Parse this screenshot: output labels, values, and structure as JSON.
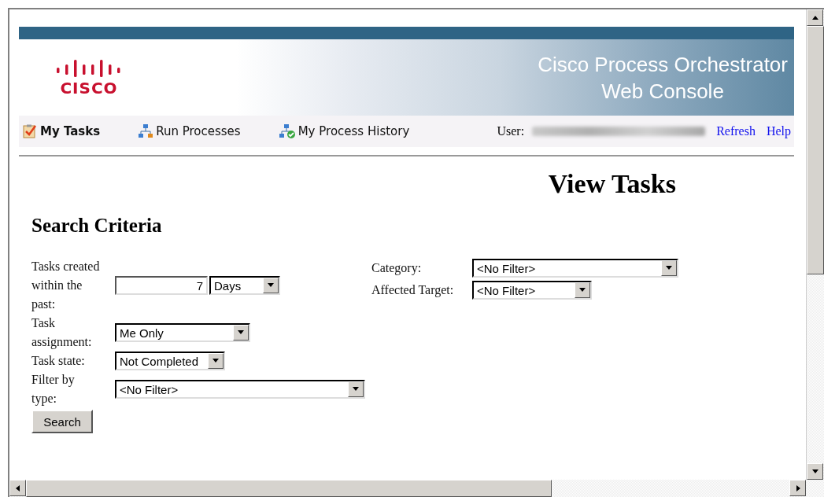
{
  "logo": {
    "wordmark": "CISCO"
  },
  "banner": {
    "title_lines": [
      "Cisco Process Orchestrator",
      "Web Console"
    ]
  },
  "nav": {
    "items": [
      {
        "label": "My Tasks",
        "kind": "tasks",
        "selected": true
      },
      {
        "label": "Run Processes",
        "kind": "run",
        "selected": false
      },
      {
        "label": "My Process History",
        "kind": "history",
        "selected": false
      }
    ],
    "user_label": "User:",
    "links": [
      "Refresh",
      "Help"
    ]
  },
  "page_title": "View Tasks",
  "section_title": "Search Criteria",
  "form_left": [
    {
      "label": "Tasks created within the past:",
      "kind": "number-unit",
      "value": "7",
      "unit": "Days"
    },
    {
      "label": "Task assignment:",
      "kind": "select",
      "value": "Me Only"
    },
    {
      "label": "Task state:",
      "kind": "select",
      "value": "Not Completed"
    },
    {
      "label": "Filter by type:",
      "kind": "select",
      "value": "<No Filter>"
    }
  ],
  "search_button": "Search",
  "form_right": [
    {
      "label": "Category:",
      "kind": "select",
      "value": "<No Filter>"
    },
    {
      "label": "Affected Target:",
      "kind": "select",
      "value": "<No Filter>"
    }
  ]
}
